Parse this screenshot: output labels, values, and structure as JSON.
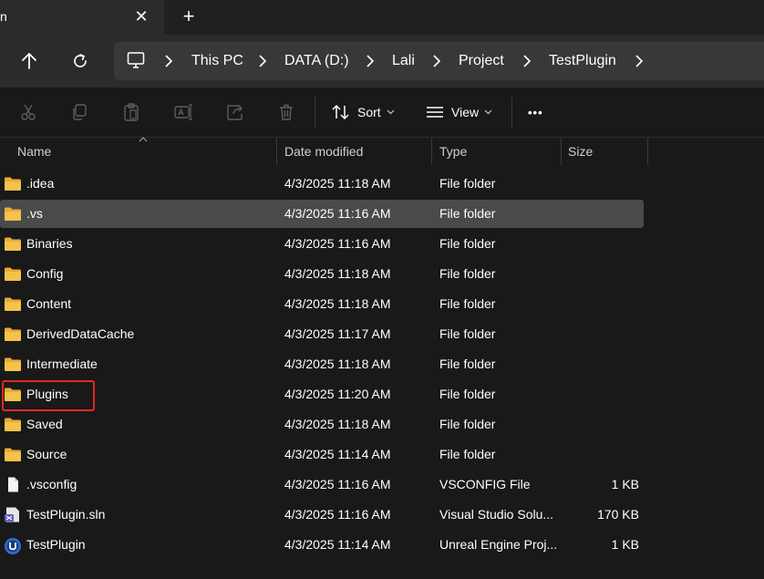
{
  "tabbar": {
    "tab_fragment": "n",
    "close_glyph": "✕",
    "new_tab_glyph": "+"
  },
  "breadcrumb": [
    "This PC",
    "DATA (D:)",
    "Lali",
    "Project",
    "TestPlugin"
  ],
  "toolbar": {
    "sort_label": "Sort",
    "view_label": "View",
    "more_label": "•••"
  },
  "columns": {
    "name": "Name",
    "date": "Date modified",
    "type": "Type",
    "size": "Size"
  },
  "files": [
    {
      "name": ".idea",
      "date": "4/3/2025 11:18 AM",
      "type": "File folder",
      "size": "",
      "icon": "folder-icon"
    },
    {
      "name": ".vs",
      "date": "4/3/2025 11:16 AM",
      "type": "File folder",
      "size": "",
      "icon": "folder-icon"
    },
    {
      "name": "Binaries",
      "date": "4/3/2025 11:16 AM",
      "type": "File folder",
      "size": "",
      "icon": "folder-icon"
    },
    {
      "name": "Config",
      "date": "4/3/2025 11:18 AM",
      "type": "File folder",
      "size": "",
      "icon": "folder-icon"
    },
    {
      "name": "Content",
      "date": "4/3/2025 11:18 AM",
      "type": "File folder",
      "size": "",
      "icon": "folder-icon"
    },
    {
      "name": "DerivedDataCache",
      "date": "4/3/2025 11:17 AM",
      "type": "File folder",
      "size": "",
      "icon": "folder-icon"
    },
    {
      "name": "Intermediate",
      "date": "4/3/2025 11:18 AM",
      "type": "File folder",
      "size": "",
      "icon": "folder-icon"
    },
    {
      "name": "Plugins",
      "date": "4/3/2025 11:20 AM",
      "type": "File folder",
      "size": "",
      "icon": "folder-icon"
    },
    {
      "name": "Saved",
      "date": "4/3/2025 11:18 AM",
      "type": "File folder",
      "size": "",
      "icon": "folder-icon"
    },
    {
      "name": "Source",
      "date": "4/3/2025 11:14 AM",
      "type": "File folder",
      "size": "",
      "icon": "folder-icon"
    },
    {
      "name": ".vsconfig",
      "date": "4/3/2025 11:16 AM",
      "type": "VSCONFIG File",
      "size": "1 KB",
      "icon": "file-icon"
    },
    {
      "name": "TestPlugin.sln",
      "date": "4/3/2025 11:16 AM",
      "type": "Visual Studio Solu...",
      "size": "170 KB",
      "icon": "solution-file-icon"
    },
    {
      "name": "TestPlugin",
      "date": "4/3/2025 11:14 AM",
      "type": "Unreal Engine Proj...",
      "size": "1 KB",
      "icon": "unreal-project-icon"
    }
  ],
  "selected_row_name": ".vs",
  "highlighted_row_name": "Plugins",
  "colors": {
    "background": "#191919",
    "folder": "#f3c34b",
    "selection": "#4a4a4a",
    "highlight_border": "#e02a23"
  }
}
